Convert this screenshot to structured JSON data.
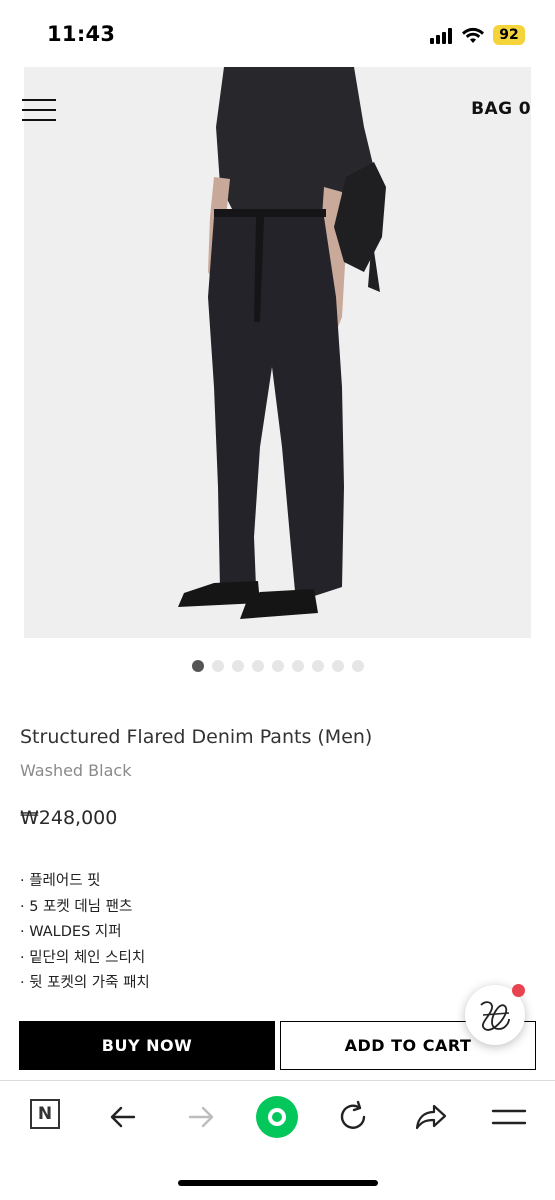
{
  "status_bar": {
    "time": "11:43",
    "battery": "92",
    "battery_color": "#f5d33b"
  },
  "header": {
    "bag_label": "BAG 0"
  },
  "gallery": {
    "count": 9,
    "active_index": 0
  },
  "product": {
    "name": "Structured Flared Denim Pants (Men)",
    "color": "Washed Black",
    "price": "₩248,000",
    "features": [
      "· 플레어드 핏",
      "· 5 포켓 데님 팬츠",
      "· WALDES 지퍼",
      "· 밑단의 체인 스티치",
      "· 뒷 포켓의 가죽 패치"
    ]
  },
  "actions": {
    "buy_now": "BUY NOW",
    "add_to_cart": "ADD TO CART"
  },
  "browser_toolbar": {
    "items": [
      "naver-icon",
      "back-arrow-icon",
      "forward-arrow-icon",
      "green-home-icon",
      "refresh-icon",
      "share-icon",
      "menu-icon"
    ],
    "brand_letter": "N",
    "accent": "#03c75a"
  }
}
